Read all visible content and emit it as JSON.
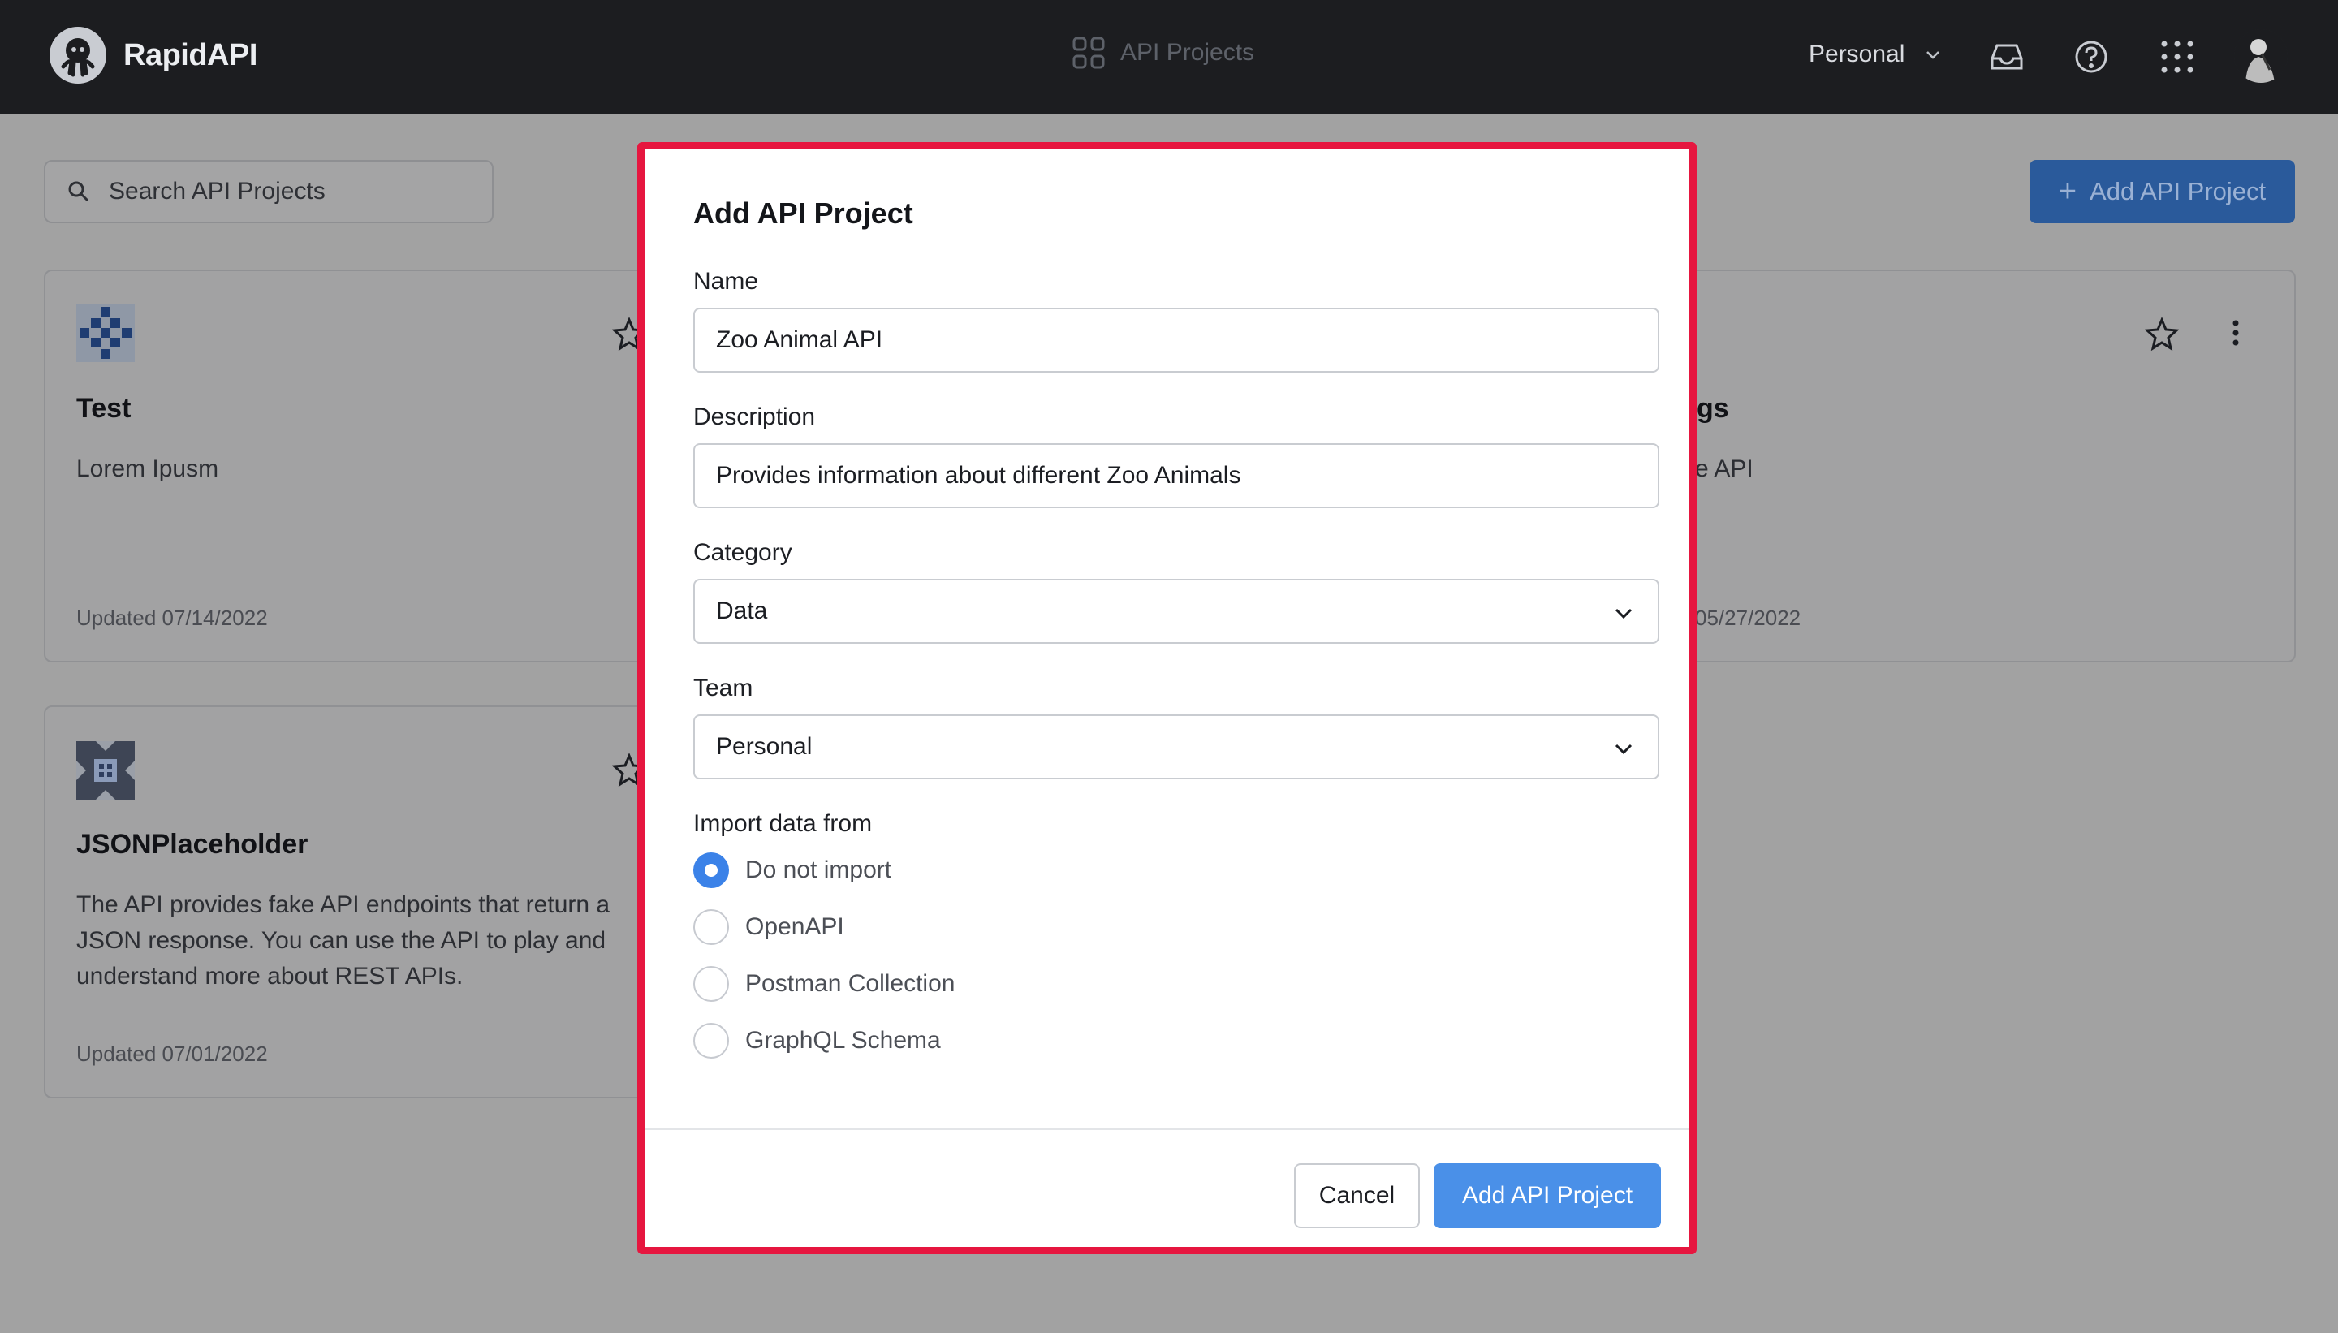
{
  "app": {
    "name": "RapidAPI"
  },
  "nav": {
    "center_label": "API Projects",
    "team": "Personal"
  },
  "toolbar": {
    "search_placeholder": "Search API Projects",
    "add_button": "Add API Project"
  },
  "cards": [
    {
      "title": "Test",
      "description": "Lorem Ipusm",
      "updated": "Updated 07/14/2022"
    },
    {
      "title_fragment": "gs",
      "description_fragment": "e API",
      "updated_fragment": "05/27/2022"
    },
    {
      "title": "JSONPlaceholder",
      "description_lines": [
        "The API provides fake API endpoints that return a",
        "JSON response. You can use the API to play and",
        "understand more about REST APIs."
      ],
      "updated": "Updated 07/01/2022"
    }
  ],
  "modal": {
    "title": "Add API Project",
    "name_label": "Name",
    "name_value": "Zoo Animal API",
    "description_label": "Description",
    "description_value": "Provides information about different Zoo Animals",
    "category_label": "Category",
    "category_value": "Data",
    "team_label": "Team",
    "team_value": "Personal",
    "import_label": "Import data from",
    "import_options": [
      {
        "label": "Do not import",
        "checked": true
      },
      {
        "label": "OpenAPI",
        "checked": false
      },
      {
        "label": "Postman Collection",
        "checked": false
      },
      {
        "label": "GraphQL Schema",
        "checked": false
      }
    ],
    "cancel_label": "Cancel",
    "submit_label": "Add API Project"
  },
  "colors": {
    "accent": "#4a90e8",
    "highlight_border": "#e6163f",
    "nav_bg": "#1c1d20"
  }
}
